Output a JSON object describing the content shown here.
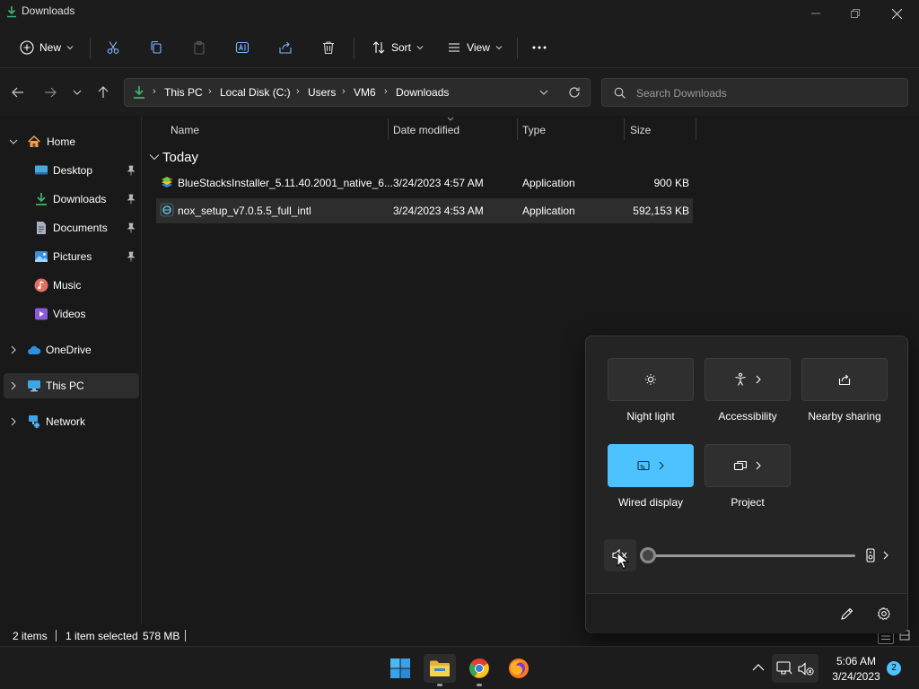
{
  "window": {
    "title": "Downloads"
  },
  "toolbar": {
    "new_label": "New",
    "sort_label": "Sort",
    "view_label": "View"
  },
  "address": {
    "crumbs": [
      "This PC",
      "Local Disk (C:)",
      "Users",
      "VM6",
      "Downloads"
    ],
    "search_placeholder": "Search Downloads"
  },
  "sidebar": {
    "home": "Home",
    "quick_access": [
      "Desktop",
      "Downloads",
      "Documents",
      "Pictures",
      "Music",
      "Videos"
    ],
    "onedrive": "OneDrive",
    "this_pc": "This PC",
    "network": "Network"
  },
  "files": {
    "columns": [
      "Name",
      "Date modified",
      "Type",
      "Size"
    ],
    "group": "Today",
    "rows": [
      {
        "name": "BlueStacksInstaller_5.11.40.2001_native_6...",
        "date": "3/24/2023 4:57 AM",
        "type": "Application",
        "size": "900 KB"
      },
      {
        "name": "nox_setup_v7.0.5.5_full_intl",
        "date": "3/24/2023 4:53 AM",
        "type": "Application",
        "size": "592,153 KB"
      }
    ]
  },
  "status": {
    "items": "2 items",
    "selected": "1 item selected",
    "size": "578 MB"
  },
  "quick_settings": {
    "tiles": [
      {
        "label": "Night light",
        "icon": "night-light-icon",
        "on": false
      },
      {
        "label": "Accessibility",
        "icon": "accessibility-icon",
        "on": false
      },
      {
        "label": "Nearby sharing",
        "icon": "share-icon",
        "on": false
      },
      {
        "label": "Wired display",
        "icon": "cast-icon",
        "on": true
      },
      {
        "label": "Project",
        "icon": "project-icon",
        "on": false
      }
    ],
    "volume_percent": 0,
    "muted": true
  },
  "taskbar": {
    "time": "5:06 AM",
    "date": "3/24/2023",
    "notification_count": "2"
  },
  "colors": {
    "accent": "#4cc2ff",
    "download_green": "#3cb371",
    "background": "#191919"
  }
}
